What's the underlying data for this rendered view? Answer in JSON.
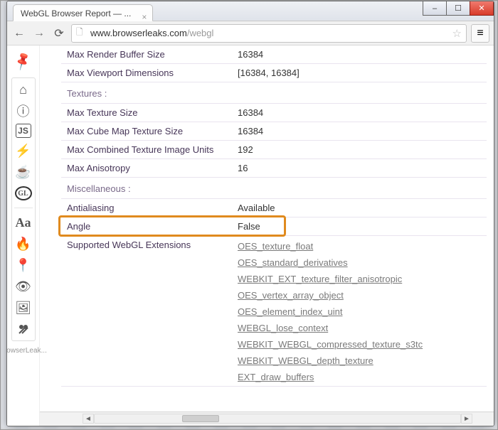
{
  "tab": {
    "title": "WebGL Browser Report — ..."
  },
  "window_buttons": {
    "min": "–",
    "max": "☐",
    "close": "✕"
  },
  "toolbar": {
    "back": "←",
    "fwd": "→",
    "reload": "⟳",
    "url_host": "www.browserleaks.com",
    "url_path": "/webgl",
    "star": "☆",
    "menu": "≡"
  },
  "sidebar": {
    "pin": "📌",
    "icons": [
      {
        "name": "home-icon",
        "glyph": "⌂"
      },
      {
        "name": "info-icon",
        "glyph": "ⓘ"
      },
      {
        "name": "javascript-icon",
        "glyph": "JS"
      },
      {
        "name": "flash-icon",
        "glyph": "⚡"
      },
      {
        "name": "java-icon",
        "glyph": "☕"
      },
      {
        "name": "webgl-icon",
        "glyph": "GL"
      },
      {
        "name": "sep",
        "glyph": ""
      },
      {
        "name": "fonts-icon",
        "glyph": "Aa"
      },
      {
        "name": "fire-icon",
        "glyph": "🔥"
      },
      {
        "name": "location-icon",
        "glyph": "📍"
      },
      {
        "name": "eye-icon",
        "glyph": "👁"
      },
      {
        "name": "image-icon",
        "glyph": "🖼"
      },
      {
        "name": "tools-icon",
        "glyph": "✖"
      }
    ],
    "credit": "BrowserLeak..."
  },
  "rows": [
    {
      "type": "kv",
      "key": "Max Render Buffer Size",
      "val": "16384"
    },
    {
      "type": "kv",
      "key": "Max Viewport Dimensions",
      "val": "[16384, 16384]"
    },
    {
      "type": "section",
      "key": "Textures :"
    },
    {
      "type": "kv",
      "key": "Max Texture Size",
      "val": "16384"
    },
    {
      "type": "kv",
      "key": "Max Cube Map Texture Size",
      "val": "16384"
    },
    {
      "type": "kv",
      "key": "Max Combined Texture Image Units",
      "val": "192"
    },
    {
      "type": "kv",
      "key": "Max Anisotropy",
      "val": "16"
    },
    {
      "type": "section",
      "key": "Miscellaneous :"
    },
    {
      "type": "kv",
      "key": "Antialiasing",
      "val": "Available"
    },
    {
      "type": "kv",
      "key": "Angle",
      "val": "False",
      "highlight": true
    },
    {
      "type": "ext",
      "key": "Supported WebGL Extensions",
      "exts": [
        "OES_texture_float",
        "OES_standard_derivatives",
        "WEBKIT_EXT_texture_filter_anisotropic",
        "OES_vertex_array_object",
        "OES_element_index_uint",
        "WEBGL_lose_context",
        "WEBKIT_WEBGL_compressed_texture_s3tc",
        "WEBKIT_WEBGL_depth_texture",
        "EXT_draw_buffers"
      ]
    }
  ]
}
